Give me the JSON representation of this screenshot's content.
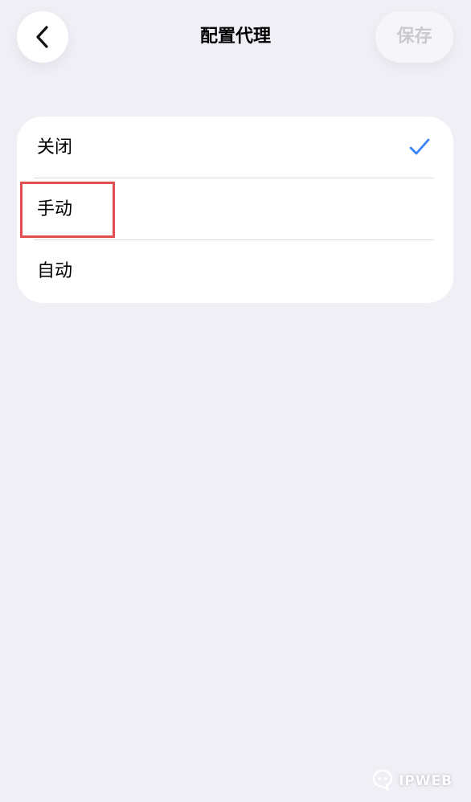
{
  "nav": {
    "title": "配置代理",
    "save_label": "保存",
    "back_icon": "chevron-left-icon"
  },
  "options": [
    {
      "label": "关闭",
      "selected": true
    },
    {
      "label": "手动",
      "selected": false
    },
    {
      "label": "自动",
      "selected": false
    }
  ],
  "check_icon": "checkmark-icon",
  "colors": {
    "background": "#f0eff5",
    "accent": "#3a82f7",
    "highlight": "#e24f4f",
    "save_disabled": "#c9c9cf"
  },
  "watermark": {
    "text": "IPWEB",
    "icon": "ipweb-logo-icon"
  }
}
